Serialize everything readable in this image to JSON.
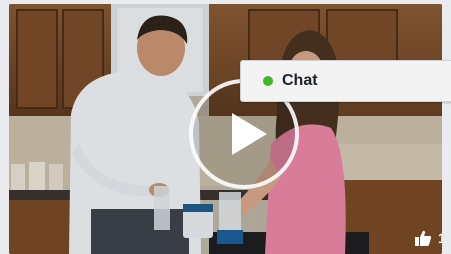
{
  "chat": {
    "label": "Chat",
    "status_color": "#42b72a"
  },
  "video": {
    "state": "paused"
  },
  "reactions": {
    "like_count": "1"
  }
}
